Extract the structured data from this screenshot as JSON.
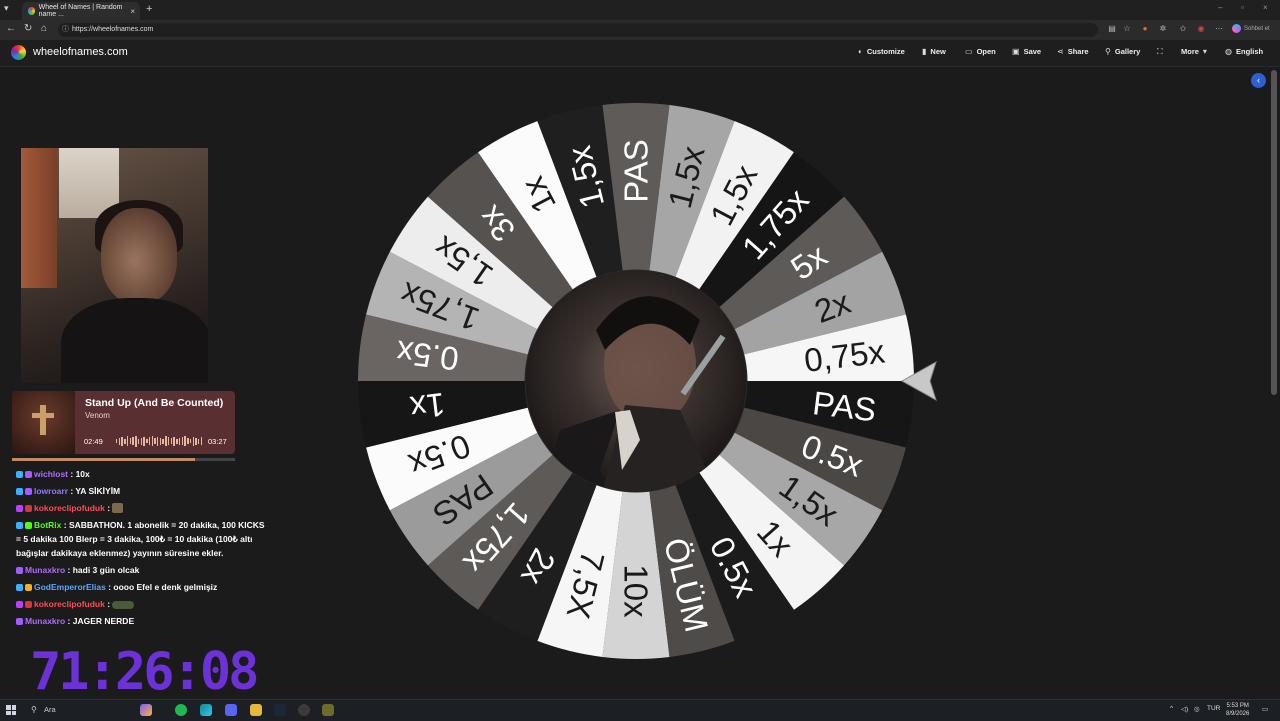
{
  "browser": {
    "tab_title": "Wheel of Names | Random name ...",
    "tab_close": "×",
    "new_tab": "+",
    "url": "https://wheelofnames.com",
    "side_chat_label": "Sohbet et"
  },
  "site": {
    "brand": "wheelofnames.com",
    "menu": [
      {
        "label": "Customize",
        "icon": "palette-icon",
        "glyph": "◐"
      },
      {
        "label": "New",
        "icon": "file-icon",
        "glyph": "▮"
      },
      {
        "label": "Open",
        "icon": "folder-icon",
        "glyph": "▭"
      },
      {
        "label": "Save",
        "icon": "save-icon",
        "glyph": "▣"
      },
      {
        "label": "Share",
        "icon": "share-icon",
        "glyph": "⋖"
      },
      {
        "label": "Gallery",
        "icon": "search-icon",
        "glyph": "⚲"
      },
      {
        "label": "",
        "icon": "fullscreen-icon",
        "glyph": "⛶"
      },
      {
        "label": "More",
        "icon": "chevron-down-icon",
        "glyph": "▾"
      },
      {
        "label": "English",
        "icon": "globe-icon",
        "glyph": "◍"
      }
    ],
    "sidebar_toggle": "‹"
  },
  "wheel": {
    "segments": [
      {
        "label": "10x",
        "color": "#d4d4d4"
      },
      {
        "label": "7,5X",
        "color": "#f6f6f6"
      },
      {
        "label": "2x",
        "color": "#1e1e1e"
      },
      {
        "label": "1,75x",
        "color": "#5e5a57"
      },
      {
        "label": "PAS",
        "color": "#9b9b9b"
      },
      {
        "label": "0.5x",
        "color": "#fbfbfb"
      },
      {
        "label": "1x",
        "color": "#161616"
      },
      {
        "label": "0.5x",
        "color": "#6a6562"
      },
      {
        "label": "1,75x",
        "color": "#b4b4b4"
      },
      {
        "label": "1,5x",
        "color": "#ededed"
      },
      {
        "label": "3x",
        "color": "#555250"
      },
      {
        "label": "1x",
        "color": "#fbfbfb"
      },
      {
        "label": "1,5x",
        "color": "#1f1f1f"
      },
      {
        "label": "PAS",
        "color": "#5f5b58"
      },
      {
        "label": "1,5x",
        "color": "#a6a6a6"
      },
      {
        "label": "1,5x",
        "color": "#f2f2f2"
      },
      {
        "label": "1,75x",
        "color": "#151515"
      },
      {
        "label": "5x",
        "color": "#5e5a57"
      },
      {
        "label": "2x",
        "color": "#a3a3a3"
      },
      {
        "label": "0,75x",
        "color": "#f6f6f6"
      },
      {
        "label": "PAS",
        "color": "#161616"
      },
      {
        "label": "0.5x",
        "color": "#4a4745"
      },
      {
        "label": "1,5x",
        "color": "#a7a7a7"
      },
      {
        "label": "1x",
        "color": "#f4f4f4"
      },
      {
        "label": "0.5x",
        "color": "#1b1b1b"
      },
      {
        "label": "ÖLÜM",
        "color": "#4e4b49"
      }
    ]
  },
  "music": {
    "title": "Stand Up (And Be Counted)",
    "artist": "Venom",
    "elapsed": "02:49",
    "duration": "03:27",
    "progress": 0.82
  },
  "chat": [
    {
      "user": "wichlost",
      "text": "10x",
      "color": "#b06cff",
      "badges": [
        "#3ab0ff",
        "#a05cff"
      ],
      "emote": ""
    },
    {
      "user": "lowroarr",
      "text": "YA SİKİYİM",
      "color": "#8a7cff",
      "badges": [
        "#3ab0ff",
        "#a05cff"
      ],
      "emote": ""
    },
    {
      "user": "kokoreclipofuduk",
      "text": "",
      "color": "#ff4a5a",
      "badges": [
        "#c03cff",
        "#d8343c"
      ],
      "emote": "small"
    },
    {
      "user": "BotRix",
      "text": "SABBATHON. 1 abonelik = 20 dakika, 100 KICKS = 5 dakika 100 Blerp = 3 dakika, 100₺ = 10 dakika (100₺ altı bağışlar dakikaya eklenmez) yayının süresine ekler.",
      "color": "#53fc18",
      "badges": [
        "#3ab0ff",
        "#53fc18"
      ],
      "emote": ""
    },
    {
      "user": "Munaxkro",
      "text": "hadi 3 gün olcak",
      "color": "#b06cff",
      "badges": [
        "#a05cff"
      ],
      "emote": ""
    },
    {
      "user": "GodEmperorElias",
      "text": "oooo Efel e denk gelmişiz",
      "color": "#5aa9ff",
      "badges": [
        "#3ab0ff",
        "#f0b020"
      ],
      "emote": ""
    },
    {
      "user": "kokoreclipofuduk",
      "text": "",
      "color": "#ff4a5a",
      "badges": [
        "#c03cff",
        "#d8343c"
      ],
      "emote": "wide"
    },
    {
      "user": "Munaxkro",
      "text": "JAGER NERDE",
      "color": "#b06cff",
      "badges": [
        "#a05cff"
      ],
      "emote": ""
    }
  ],
  "timer": "71:26:08",
  "taskbar": {
    "search": "Ara",
    "lang": "TUR",
    "time": "5:53 PM",
    "date": "8/9/2026"
  }
}
